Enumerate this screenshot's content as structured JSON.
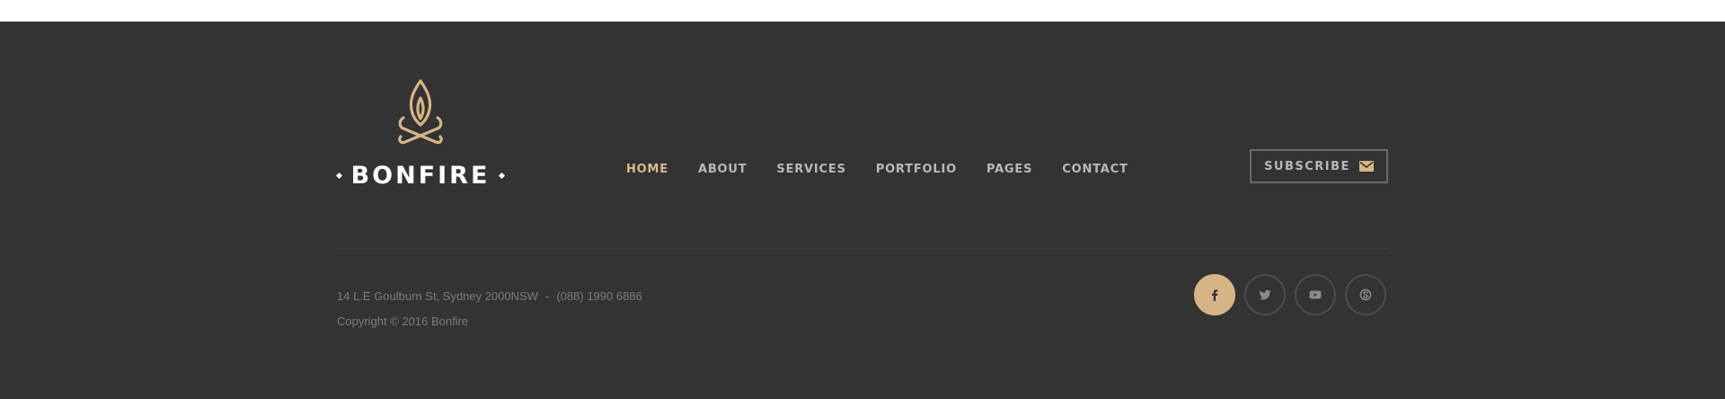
{
  "brand": {
    "name": "BONFIRE",
    "accent_color": "#d6b486",
    "logo_icon": "bonfire-flame-icon"
  },
  "nav": {
    "items": [
      {
        "label": "HOME",
        "active": true
      },
      {
        "label": "ABOUT",
        "active": false
      },
      {
        "label": "SERVICES",
        "active": false
      },
      {
        "label": "PORTFOLIO",
        "active": false
      },
      {
        "label": "PAGES",
        "active": false
      },
      {
        "label": "CONTACT",
        "active": false
      }
    ]
  },
  "subscribe": {
    "label": "SUBSCRIBE",
    "icon": "envelope-icon"
  },
  "contact": {
    "address": "14 L.E Goulburn St, Sydney 2000NSW",
    "separator": "-",
    "phone": "(088) 1990 6886",
    "copyright": "Copyright © 2016 Bonfire"
  },
  "social": [
    {
      "icon": "facebook-icon",
      "active": true
    },
    {
      "icon": "twitter-icon",
      "active": false
    },
    {
      "icon": "youtube-icon",
      "active": false
    },
    {
      "icon": "skype-icon",
      "active": false
    }
  ],
  "colors": {
    "background": "#333333",
    "text_muted": "#7b7b7b",
    "nav_text": "#b8b8b8",
    "nav_active": "#dbb98a"
  }
}
